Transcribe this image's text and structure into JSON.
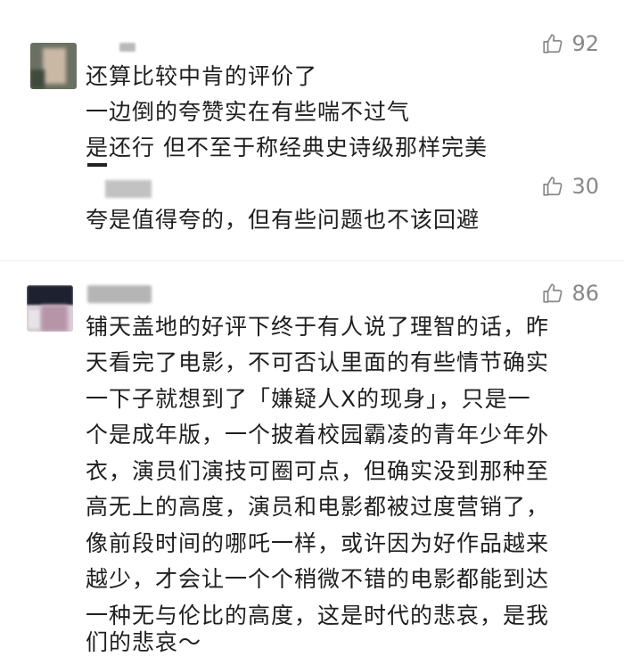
{
  "comments": [
    {
      "likes": "92",
      "lines": [
        "还算比较中肯的评价了",
        "一边倒的夸赞实在有些喘不过气",
        "是还行 但不至于称经典史诗级那样完美"
      ]
    },
    {
      "likes": "30",
      "lines": [
        "夸是值得夸的，但有些问题也不该回避"
      ]
    },
    {
      "likes": "86",
      "lines": [
        "铺天盖地的好评下终于有人说了理智的话，昨",
        "天看完了电影，不可否认里面的有些情节确实",
        "一下子就想到了「嫌疑人X的现身」，只是一",
        "个是成年版，一个披着校园霸凌的青年少年外",
        "衣，演员们演技可圈可点，但确实没到那种至",
        "高无上的高度，演员和电影都被过度营销了，",
        "像前段时间的哪吒一样，或许因为好作品越来",
        "越少，才会让一个个稍微不错的电影都能到达",
        "一种无与伦比的高度，这是时代的悲哀，是我",
        "们的悲哀～"
      ]
    }
  ],
  "colors": {
    "text": "#1f1f1f",
    "meta": "#888888"
  },
  "icons": {
    "like": "thumbs-up-icon"
  }
}
